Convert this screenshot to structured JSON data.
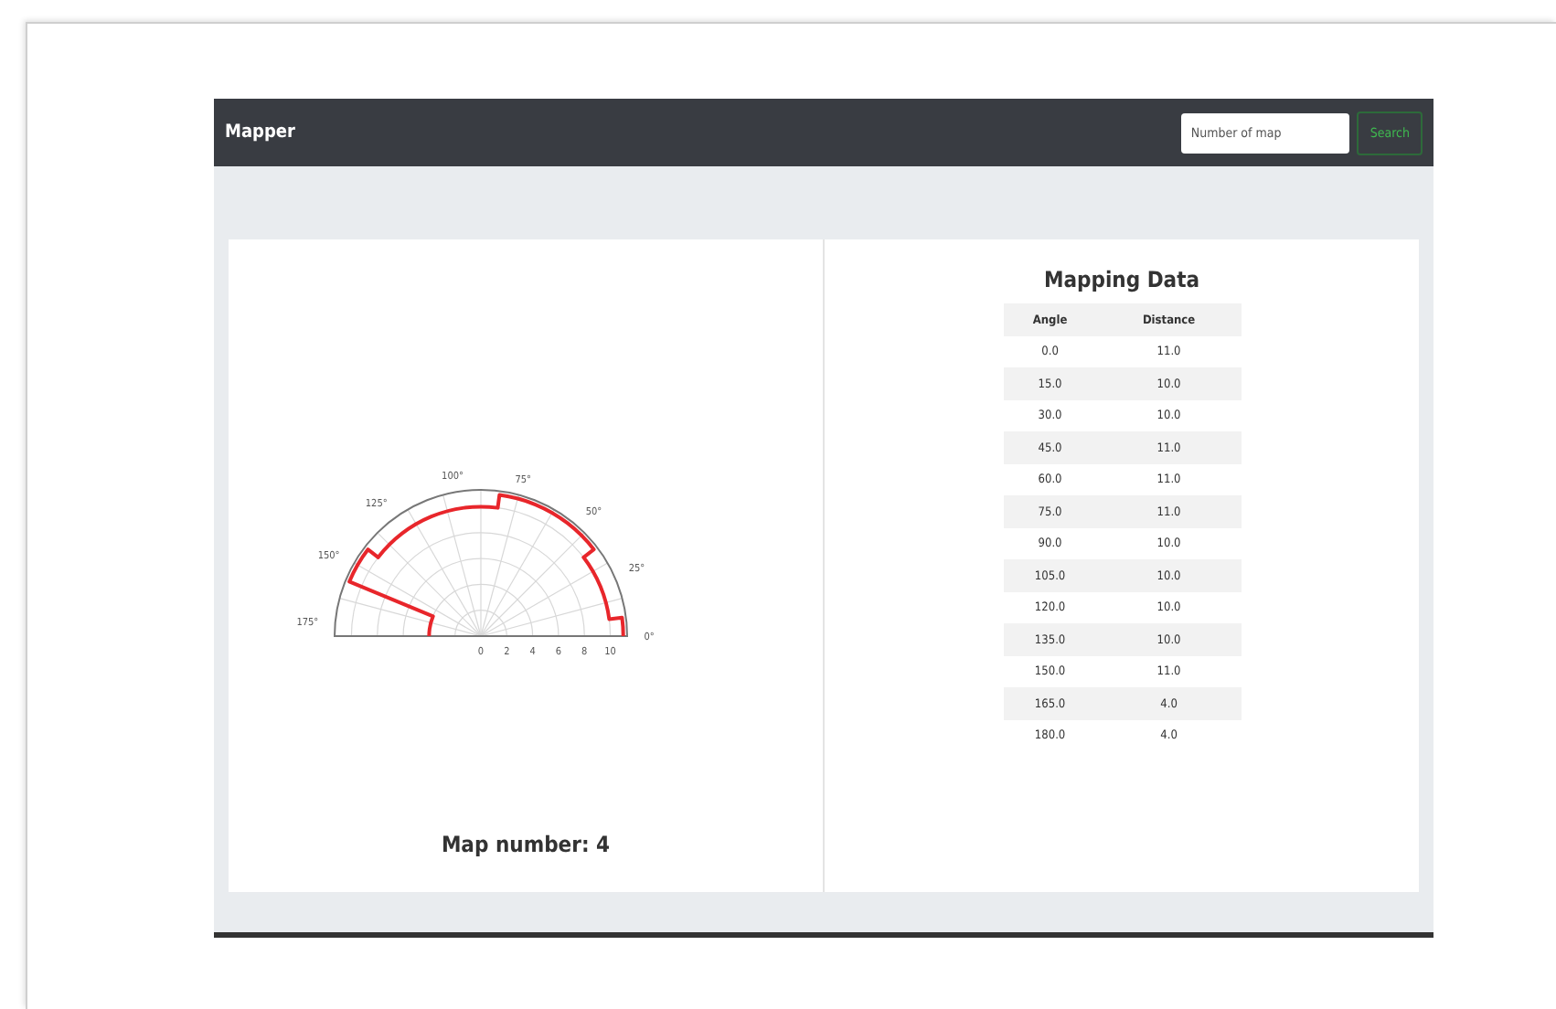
{
  "navbar": {
    "brand": "Mapper",
    "search": {
      "placeholder": "Number of map"
    },
    "search_button": "Search"
  },
  "map_panel": {
    "angle_labels": [
      "0°",
      "25°",
      "50°",
      "75°",
      "100°",
      "125°",
      "150°",
      "175°"
    ],
    "radius_labels": [
      "0",
      "2",
      "4",
      "6",
      "8",
      "10"
    ],
    "caption": "Map number: 4"
  },
  "data_panel": {
    "title": "Mapping Data",
    "columns": [
      "Angle",
      "Distance"
    ],
    "rows": [
      [
        "0.0",
        "11.0"
      ],
      [
        "15.0",
        "10.0"
      ],
      [
        "30.0",
        "10.0"
      ],
      [
        "45.0",
        "11.0"
      ],
      [
        "60.0",
        "11.0"
      ],
      [
        "75.0",
        "11.0"
      ],
      [
        "90.0",
        "10.0"
      ],
      [
        "105.0",
        "10.0"
      ],
      [
        "120.0",
        "10.0"
      ],
      [
        "135.0",
        "10.0"
      ],
      [
        "150.0",
        "11.0"
      ],
      [
        "165.0",
        "4.0"
      ],
      [
        "180.0",
        "4.0"
      ]
    ]
  }
}
